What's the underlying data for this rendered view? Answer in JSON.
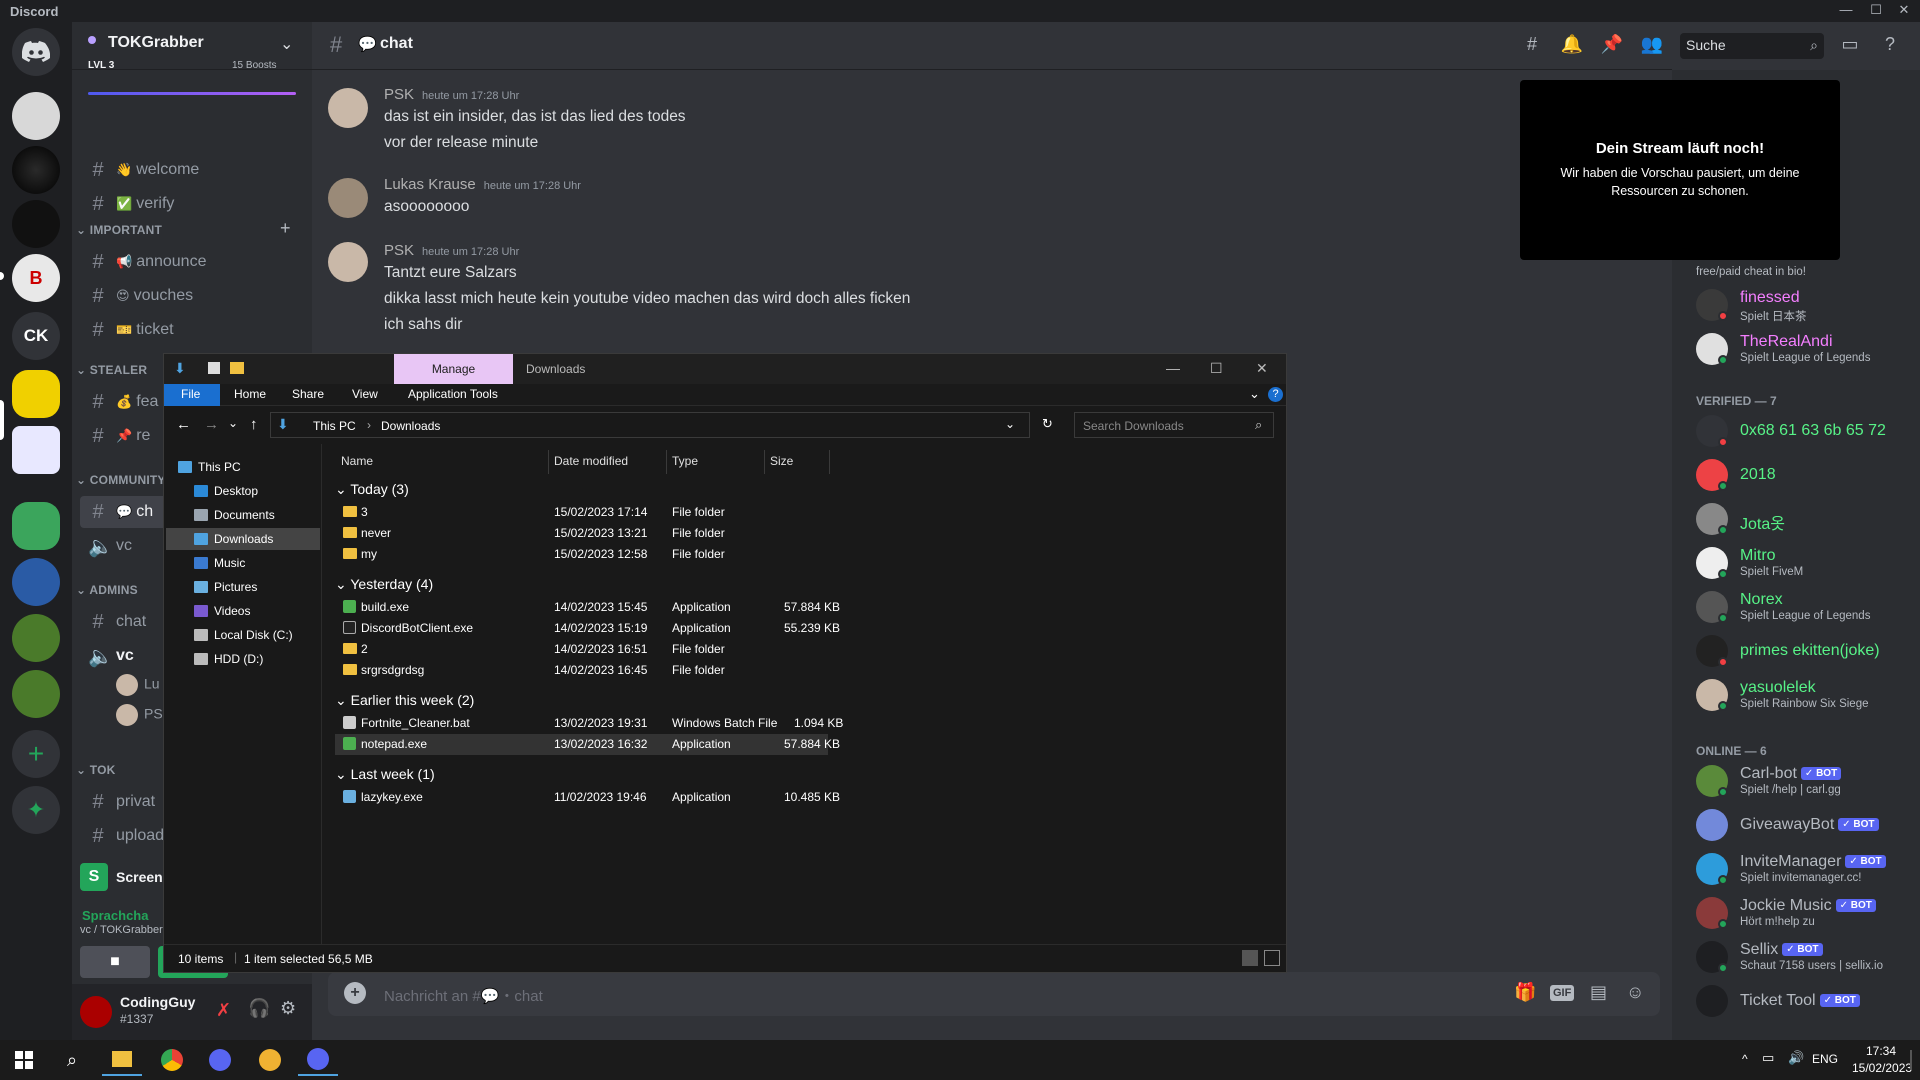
{
  "window": {
    "app_title": "Discord",
    "minimize": "—",
    "maximize": "☐",
    "close": "✕"
  },
  "server": {
    "name": "TOKGrabber",
    "level": "LVL 3",
    "boosts": "15 Boosts",
    "rail_text_server": "CK"
  },
  "channels": [
    {
      "name": "welcome",
      "emoji": "👋",
      "type": "text"
    },
    {
      "name": "verify",
      "emoji": "✅",
      "type": "text"
    }
  ],
  "categories": {
    "important": "IMPORTANT",
    "stealer": "STEALER",
    "community": "COMMUNITY",
    "admins": "ADMINS",
    "tok": "TOK"
  },
  "important_channels": [
    {
      "name": "announce",
      "emoji": "📢"
    },
    {
      "name": "vouches",
      "emoji": "😍"
    },
    {
      "name": "ticket",
      "emoji": "🎫"
    }
  ],
  "stealer_channels": [
    {
      "name": "fea",
      "emoji": "💰"
    },
    {
      "name": "re",
      "emoji": "📌"
    }
  ],
  "community_channels": [
    {
      "name": "ch",
      "emoji": "💬"
    },
    {
      "name": "vc",
      "emoji": ""
    }
  ],
  "admin_channels": [
    {
      "name": "chat"
    },
    {
      "name": "vc"
    }
  ],
  "admin_vc_users": [
    "Lu",
    "PS"
  ],
  "tok_channels": [
    {
      "name": "privat"
    },
    {
      "name": "upload"
    }
  ],
  "screen_share_label": "Screen",
  "voice": {
    "status": "Sprachcha",
    "channel": "vc / TOKGrabber"
  },
  "user": {
    "name": "CodingGuy",
    "tag": "#1337"
  },
  "chat": {
    "channel": "chat",
    "channel_emoji": "💬",
    "search_placeholder": "Suche",
    "composer_placeholder": "Nachricht an #💬・chat",
    "messages": [
      {
        "author": "PSK",
        "time": "heute um 17:28 Uhr",
        "lines": [
          "das ist ein insider, das ist das lied des todes",
          "vor der release minute"
        ]
      },
      {
        "author": "Lukas Krause",
        "time": "heute um 17:28 Uhr",
        "lines": [
          "asoooooooo"
        ]
      },
      {
        "author": "PSK",
        "time": "heute um 17:28 Uhr",
        "lines": [
          "Tantzt eure Salzars",
          "dikka lasst mich heute kein youtube video machen das wird doch alles ficken",
          "ich sahs dir"
        ]
      }
    ]
  },
  "stream": {
    "title": "Dein Stream läuft noch!",
    "body": "Wir haben die Vorschau pausiert, um deine Ressourcen zu schonen."
  },
  "members": {
    "top_partial_sub": "ung",
    "top_sub2": "free/paid cheat in bio!",
    "top_list": [
      {
        "name": "finessed",
        "sub": "Spielt 日本茶",
        "color": "#f47fff"
      },
      {
        "name": "TheRealAndi",
        "sub": "Spielt League of Legends",
        "color": "#f47fff"
      }
    ],
    "verified_header": "VERIFIED — 7",
    "verified": [
      {
        "name": "0x68 61 63 6b 65 72",
        "sub": "",
        "color": "#57f287"
      },
      {
        "name": "2018",
        "sub": "",
        "color": "#57f287"
      },
      {
        "name": "Jota옷",
        "sub": "",
        "color": "#57f287"
      },
      {
        "name": "Mitro",
        "sub": "Spielt FiveM",
        "color": "#57f287"
      },
      {
        "name": "Norex",
        "sub": "Spielt League of Legends",
        "color": "#57f287"
      },
      {
        "name": "primes ekitten(joke)",
        "sub": "",
        "color": "#57f287"
      },
      {
        "name": "yasuolelek",
        "sub": "Spielt Rainbow Six Siege",
        "color": "#57f287"
      }
    ],
    "online_header": "ONLINE — 6",
    "online": [
      {
        "name": "Carl-bot",
        "sub": "Spielt /help | carl.gg"
      },
      {
        "name": "GiveawayBot",
        "sub": ""
      },
      {
        "name": "InviteManager",
        "sub": "Spielt invitemanager.cc!"
      },
      {
        "name": "Jockie Music",
        "sub": "Hört m!help zu"
      },
      {
        "name": "Sellix",
        "sub": "Schaut 7158 users | sellix.io"
      },
      {
        "name": "Ticket Tool",
        "sub": ""
      }
    ],
    "bot_label": "✓ BOT"
  },
  "explorer": {
    "tab_manage": "Manage",
    "title": "Downloads",
    "ribbon_tabs": [
      "File",
      "Home",
      "Share",
      "View",
      "Application Tools"
    ],
    "breadcrumb": [
      "This PC",
      "Downloads"
    ],
    "search_placeholder": "Search Downloads",
    "nav": [
      "This PC",
      "Desktop",
      "Documents",
      "Downloads",
      "Music",
      "Pictures",
      "Videos",
      "Local Disk (C:)",
      "HDD (D:)"
    ],
    "columns": [
      "Name",
      "Date modified",
      "Type",
      "Size"
    ],
    "groups": [
      {
        "label": "Today (3)",
        "files": [
          {
            "name": "3",
            "date": "15/02/2023 17:14",
            "type": "File folder",
            "size": "",
            "kind": "folder"
          },
          {
            "name": "never",
            "date": "15/02/2023 13:21",
            "type": "File folder",
            "size": "",
            "kind": "folder"
          },
          {
            "name": "my",
            "date": "15/02/2023 12:58",
            "type": "File folder",
            "size": "",
            "kind": "folder"
          }
        ]
      },
      {
        "label": "Yesterday (4)",
        "files": [
          {
            "name": "build.exe",
            "date": "14/02/2023 15:45",
            "type": "Application",
            "size": "57.884 KB",
            "kind": "app"
          },
          {
            "name": "DiscordBotClient.exe",
            "date": "14/02/2023 15:19",
            "type": "Application",
            "size": "55.239 KB",
            "kind": "app"
          },
          {
            "name": "2",
            "date": "14/02/2023 16:51",
            "type": "File folder",
            "size": "",
            "kind": "folder"
          },
          {
            "name": "srgrsdgrdsg",
            "date": "14/02/2023 16:45",
            "type": "File folder",
            "size": "",
            "kind": "folder"
          }
        ]
      },
      {
        "label": "Earlier this week (2)",
        "files": [
          {
            "name": "Fortnite_Cleaner.bat",
            "date": "13/02/2023 19:31",
            "type": "Windows Batch File",
            "size": "1.094 KB",
            "kind": "bat"
          },
          {
            "name": "notepad.exe",
            "date": "13/02/2023 16:32",
            "type": "Application",
            "size": "57.884 KB",
            "kind": "app"
          }
        ]
      },
      {
        "label": "Last week (1)",
        "files": [
          {
            "name": "lazykey.exe",
            "date": "11/02/2023 19:46",
            "type": "Application",
            "size": "10.485 KB",
            "kind": "key"
          }
        ]
      }
    ],
    "status_items": "10 items",
    "status_selected": "1 item selected  56,5 MB"
  },
  "taskbar": {
    "lang": "ENG",
    "time": "17:34",
    "date": "15/02/2023"
  }
}
